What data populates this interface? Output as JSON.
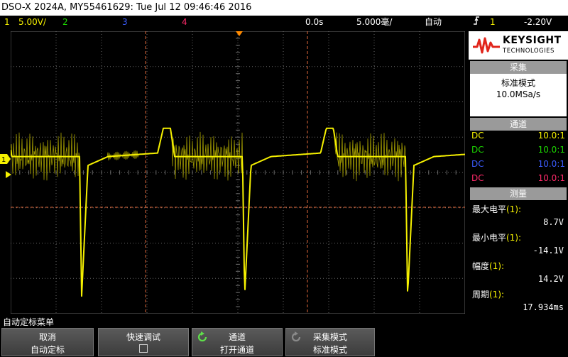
{
  "title": "DSO-X 2024A, MY55461629: Tue Jul 12 09:46:46 2016",
  "status": {
    "ch1_num": "1",
    "ch1_scale": "5.00V/",
    "ch2_num": "2",
    "ch3_num": "3",
    "ch4_num": "4",
    "time_offset": "0.0s",
    "time_scale": "5.000毫/",
    "trigger_mode": "自动",
    "trigger_icon": "trigger-slope-rising",
    "trigger_ch": "1",
    "trigger_level": "-2.20V"
  },
  "logo": {
    "brand": "KEYSIGHT",
    "sub": "TECHNOLOGIES"
  },
  "acquisition": {
    "header": "采集",
    "mode": "标准模式",
    "rate": "10.0MSa/s"
  },
  "channels": {
    "header": "通道",
    "rows": [
      {
        "coupling": "DC",
        "probe": "10.0:1",
        "color": "#f5f000"
      },
      {
        "coupling": "DC",
        "probe": "10.0:1",
        "color": "#1cd800"
      },
      {
        "coupling": "DC",
        "probe": "10.0:1",
        "color": "#3b5cff"
      },
      {
        "coupling": "DC",
        "probe": "10.0:1",
        "color": "#ff2a6a"
      }
    ]
  },
  "measure": {
    "header": "测量",
    "items": [
      {
        "label": "最大电平",
        "src": "(1):",
        "value": "8.7V"
      },
      {
        "label": "最小电平",
        "src": "(1):",
        "value": "-14.1V"
      },
      {
        "label": "幅度",
        "src": "(1):",
        "value": "14.2V"
      },
      {
        "label": "周期",
        "src": "(1):",
        "value": "17.934ms"
      }
    ]
  },
  "menu_title": "自动定标菜单",
  "softkeys": [
    {
      "line1": "取消",
      "line2": "自动定标"
    },
    {
      "line1": "快速调试",
      "line2": ""
    },
    {
      "line1": "通道",
      "line2": "打开通道"
    },
    {
      "line1": "采集模式",
      "line2": "标准模式"
    }
  ],
  "colors": {
    "ch1": "#f5f000",
    "ch2": "#1cd800",
    "ch3": "#3b5cff",
    "ch4": "#ff2a6a",
    "grid": "#6a6a6a",
    "cursor": "#e0683a",
    "trigger_marker": "#ff8a00"
  },
  "waveform": {
    "description_units": "divisions",
    "vertical_scale_v_per_div": 5.0,
    "time_scale_ms_per_div": 5.0,
    "baseline_level_div": 0.45,
    "pulse_level_div": 1.25,
    "spike_low_div": -3.5,
    "period_ms": 17.934
  }
}
